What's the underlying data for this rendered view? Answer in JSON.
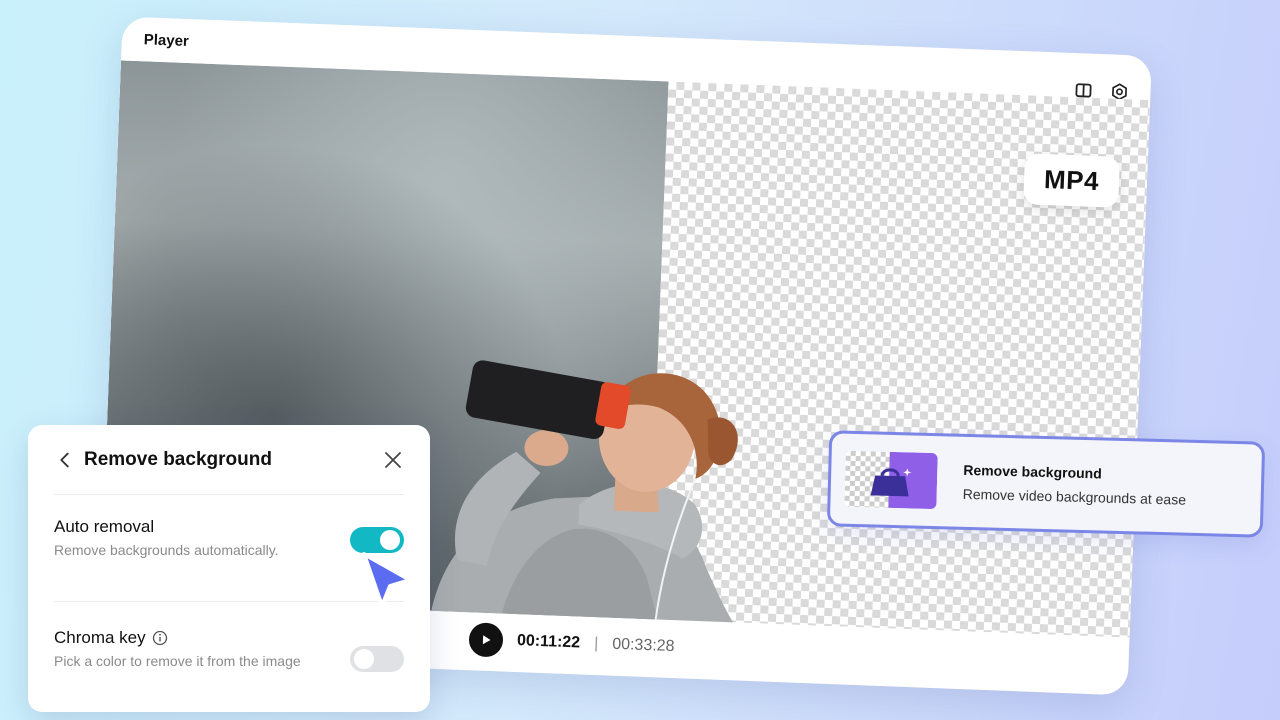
{
  "player": {
    "title": "Player",
    "format_badge": "MP4",
    "time_current": "00:11:22",
    "time_separator": "|",
    "time_total": "00:33:28"
  },
  "panel": {
    "title": "Remove background",
    "options": [
      {
        "title": "Auto removal",
        "description": "Remove backgrounds automatically.",
        "enabled": true
      },
      {
        "title": "Chroma key",
        "description": "Pick a color to remove it from the image",
        "enabled": false
      }
    ]
  },
  "feature_card": {
    "title": "Remove background",
    "description": "Remove video backgrounds at ease"
  },
  "colors": {
    "toggle_on": "#12b9c5",
    "accent_blue": "#5b6cf0",
    "card_border": "#7b86e6",
    "thumb_purple": "#8f5fe8"
  },
  "icons": {
    "layout": "split-panel-icon",
    "settings": "settings-icon",
    "play": "play-icon",
    "back": "chevron-left-icon",
    "close": "close-icon",
    "info": "info-icon",
    "cursor": "cursor-pointer-icon"
  }
}
